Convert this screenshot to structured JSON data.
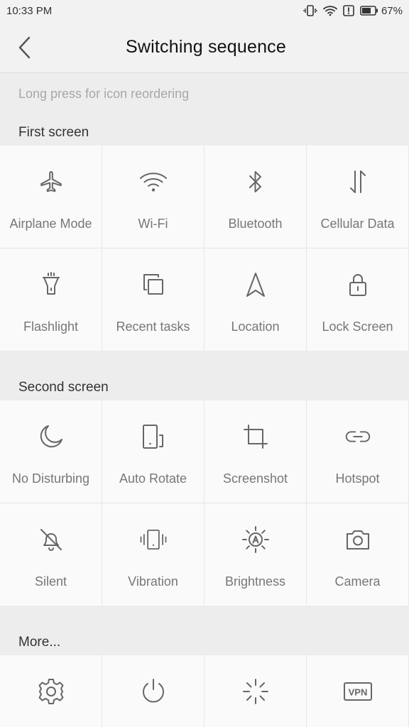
{
  "status_bar": {
    "time": "10:33 PM",
    "battery": "67%"
  },
  "header": {
    "title": "Switching sequence"
  },
  "hint": "Long press for icon reordering",
  "sections": {
    "first": {
      "title": "First screen",
      "tiles": [
        {
          "label": "Airplane Mode",
          "icon": "airplane-icon"
        },
        {
          "label": "Wi-Fi",
          "icon": "wifi-icon"
        },
        {
          "label": "Bluetooth",
          "icon": "bluetooth-icon"
        },
        {
          "label": "Cellular Data",
          "icon": "cellular-data-icon"
        },
        {
          "label": "Flashlight",
          "icon": "flashlight-icon"
        },
        {
          "label": "Recent tasks",
          "icon": "recent-tasks-icon"
        },
        {
          "label": "Location",
          "icon": "location-icon"
        },
        {
          "label": "Lock Screen",
          "icon": "lock-icon"
        }
      ]
    },
    "second": {
      "title": "Second screen",
      "tiles": [
        {
          "label": "No Disturbing",
          "icon": "moon-icon"
        },
        {
          "label": "Auto Rotate",
          "icon": "auto-rotate-icon"
        },
        {
          "label": "Screenshot",
          "icon": "screenshot-icon"
        },
        {
          "label": "Hotspot",
          "icon": "link-icon"
        },
        {
          "label": "Silent",
          "icon": "bell-off-icon"
        },
        {
          "label": "Vibration",
          "icon": "vibration-icon"
        },
        {
          "label": "Brightness",
          "icon": "brightness-icon"
        },
        {
          "label": "Camera",
          "icon": "camera-icon"
        }
      ]
    },
    "more": {
      "title": "More...",
      "tiles": [
        {
          "label": "",
          "icon": "gear-icon"
        },
        {
          "label": "",
          "icon": "power-icon"
        },
        {
          "label": "",
          "icon": "loading-icon"
        },
        {
          "label": "VPN",
          "icon": "vpn-icon"
        }
      ]
    }
  }
}
